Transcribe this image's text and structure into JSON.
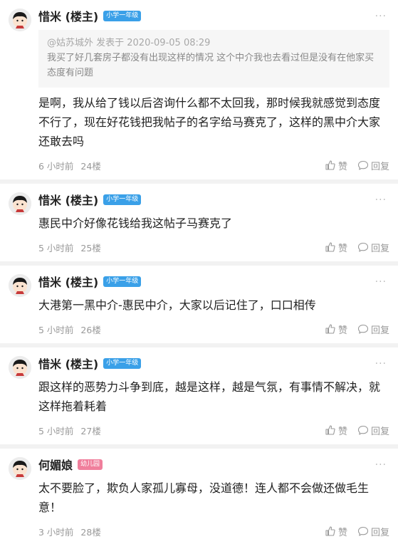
{
  "more_label": "···",
  "colors": {
    "accent": "#3aa0e8",
    "kindergarten": "#f07f9c",
    "meta": "#999999"
  },
  "posts": [
    {
      "user": "惜米 (楼主)",
      "badge": "小学一年级",
      "badge_color": "#3aa0e8",
      "quote": {
        "header": "@姑苏城外 发表于 2020-09-05 08:29",
        "text": "我买了好几套房子都没有出现这样的情况  这个中介我也去看过但是没有在他家买  态度有问题"
      },
      "content": "是啊，我从给了钱以后咨询什么都不太回我，那时候我就感觉到态度不行了，现在好花钱把我帖子的名字给马赛克了，这样的黑中介大家还敢去吗",
      "time": "6 小时前",
      "floor": "24楼",
      "like_label": "赞",
      "reply_label": "回复"
    },
    {
      "user": "惜米 (楼主)",
      "badge": "小学一年级",
      "badge_color": "#3aa0e8",
      "content": "惠民中介好像花钱给我这帖子马赛克了",
      "time": "5 小时前",
      "floor": "25楼",
      "like_label": "赞",
      "reply_label": "回复"
    },
    {
      "user": "惜米 (楼主)",
      "badge": "小学一年级",
      "badge_color": "#3aa0e8",
      "content": "大港第一黑中介-惠民中介，大家以后记住了，口口相传",
      "time": "5 小时前",
      "floor": "26楼",
      "like_label": "赞",
      "reply_label": "回复"
    },
    {
      "user": "惜米 (楼主)",
      "badge": "小学一年级",
      "badge_color": "#3aa0e8",
      "content": "跟这样的恶势力斗争到底，越是这样，越是气氛，有事情不解决，就这样拖着耗着",
      "time": "5 小时前",
      "floor": "27楼",
      "like_label": "赞",
      "reply_label": "回复"
    },
    {
      "user": "何媚娘",
      "badge": "幼儿园",
      "badge_color": "#f07f9c",
      "content": "太不要脸了，欺负人家孤儿寡母，没道德！连人都不会做还做毛生意！",
      "time": "3 小时前",
      "floor": "28楼",
      "like_label": "赞",
      "reply_label": "回复"
    }
  ]
}
